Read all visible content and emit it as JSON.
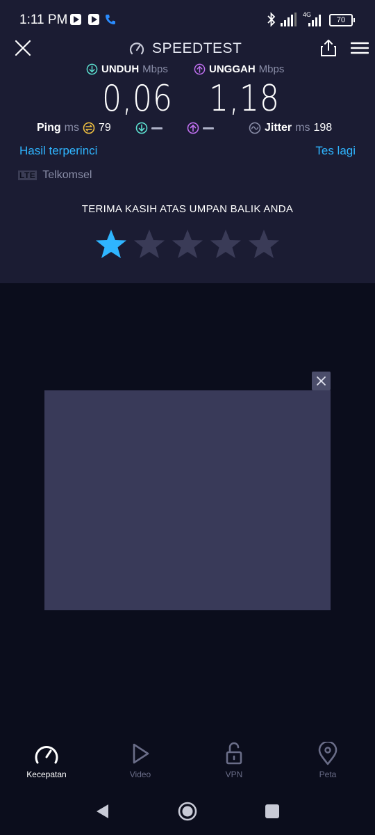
{
  "status_bar": {
    "time": "1:11 PM",
    "network_label": "4G",
    "battery_level": "70"
  },
  "header": {
    "title": "SPEEDTEST"
  },
  "results": {
    "download": {
      "label": "UNDUH",
      "unit": "Mbps",
      "value": "0,06"
    },
    "upload": {
      "label": "UNGGAH",
      "unit": "Mbps",
      "value": "1,18"
    },
    "ping": {
      "label": "Ping",
      "unit": "ms",
      "value": "79"
    },
    "jitter": {
      "label": "Jitter",
      "unit": "ms",
      "value": "198"
    }
  },
  "links": {
    "detailed_results": "Hasil terperinci",
    "test_again": "Tes lagi"
  },
  "provider": {
    "tech": "LTE",
    "name": "Telkomsel"
  },
  "feedback": {
    "title": "TERIMA KASIH ATAS UMPAN BALIK ANDA",
    "rating": 1,
    "max_rating": 5
  },
  "bottom_nav": {
    "items": [
      {
        "label": "Kecepatan",
        "icon": "speedometer-icon",
        "active": true
      },
      {
        "label": "Video",
        "icon": "play-icon",
        "active": false
      },
      {
        "label": "VPN",
        "icon": "unlock-icon",
        "active": false
      },
      {
        "label": "Peta",
        "icon": "map-pin-icon",
        "active": false
      }
    ]
  },
  "colors": {
    "background": "#0b0d1c",
    "panel": "#1b1c33",
    "accent_link": "#2fb5ff",
    "download_accent": "#5ce0d0",
    "upload_accent": "#c070f0",
    "star_active": "#2fb5ff",
    "star_inactive": "#3a3b57",
    "ad_placeholder": "#393a59"
  }
}
